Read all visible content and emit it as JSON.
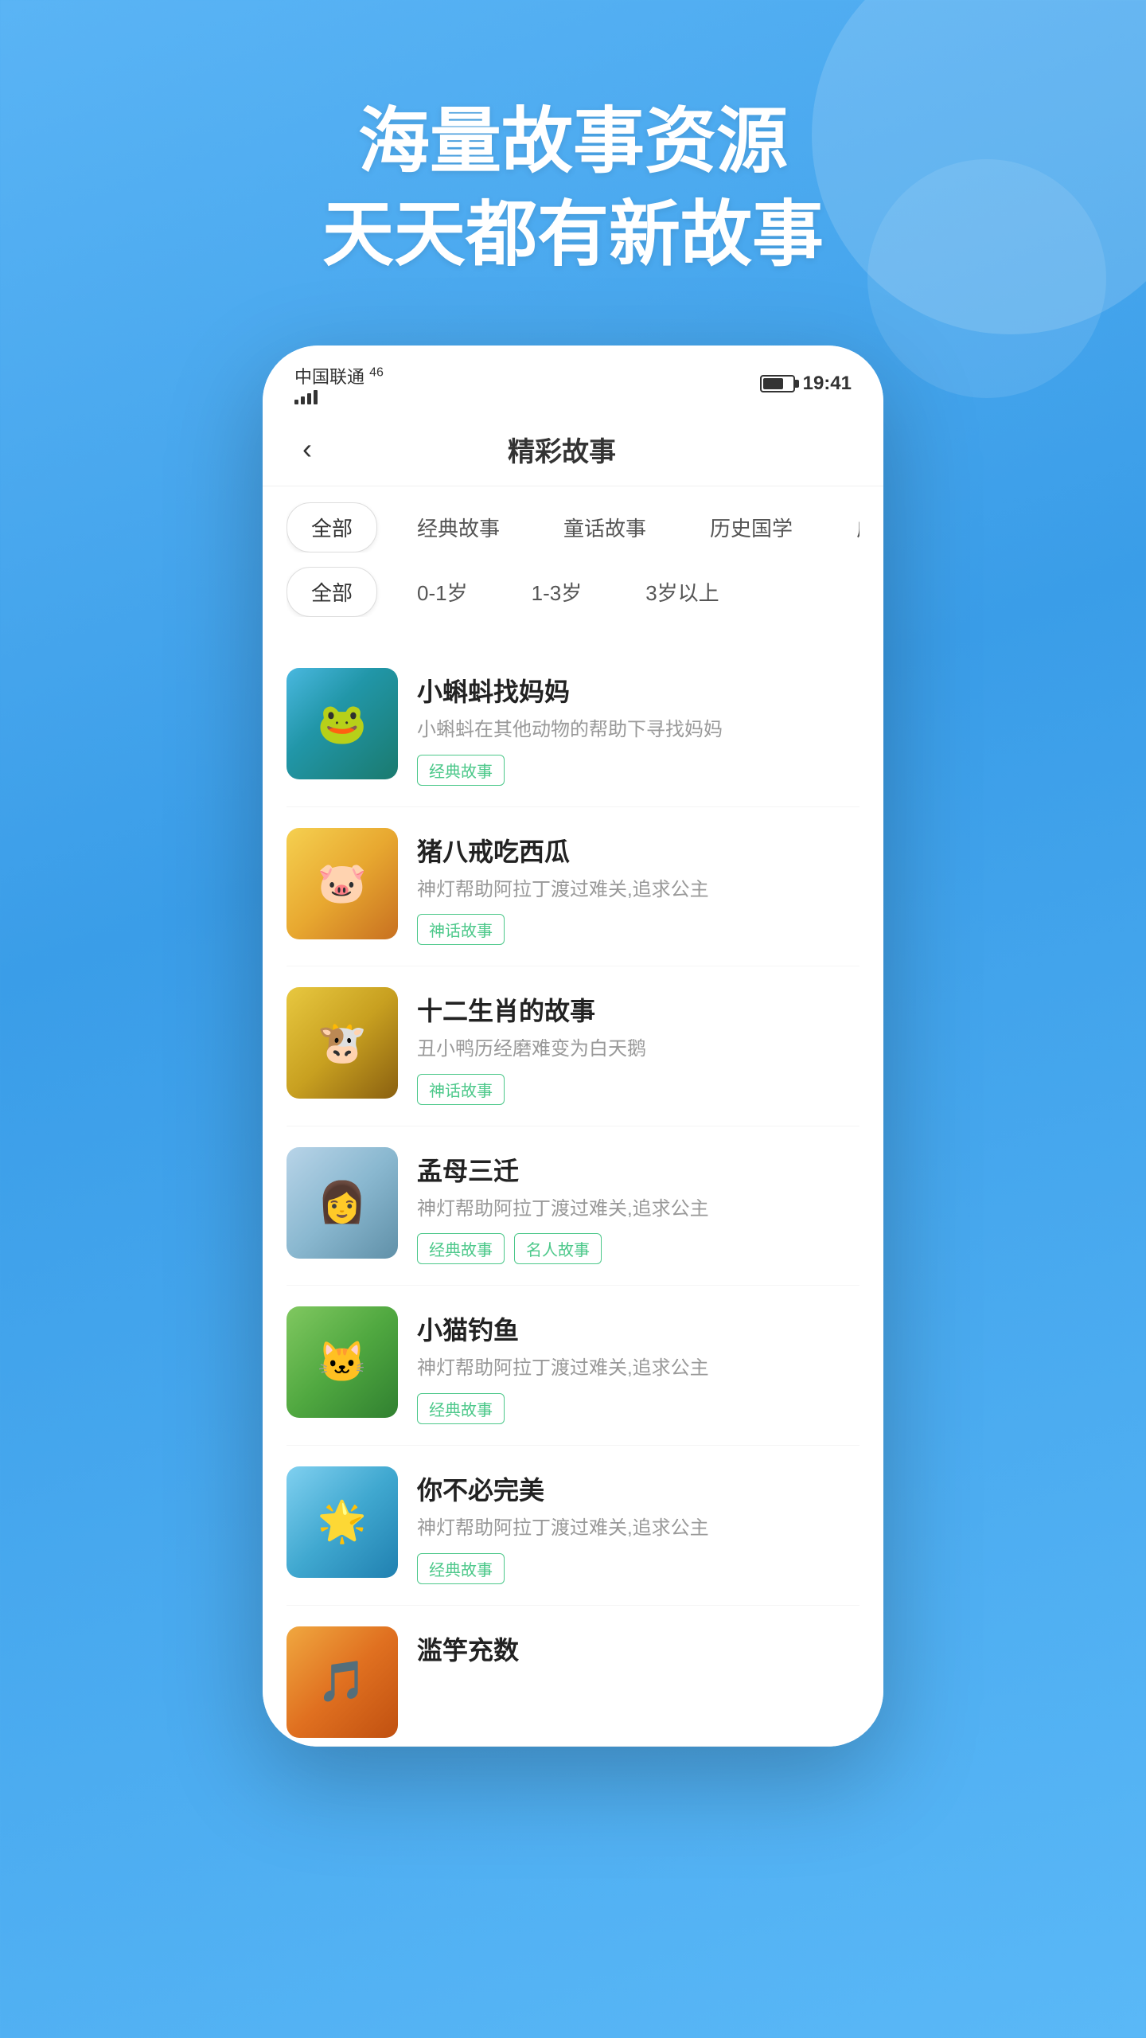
{
  "hero": {
    "line1": "海量故事资源",
    "line2": "天天都有新故事"
  },
  "statusBar": {
    "carrier": "中国联通",
    "signal": "46",
    "time": "19:41"
  },
  "nav": {
    "back": "‹",
    "title": "精彩故事"
  },
  "filters": {
    "categoryRow": [
      {
        "label": "全部",
        "active": true
      },
      {
        "label": "经典故事",
        "active": false
      },
      {
        "label": "童话故事",
        "active": false
      },
      {
        "label": "历史国学",
        "active": false
      },
      {
        "label": "成语故",
        "active": false
      }
    ],
    "ageRow": [
      {
        "label": "全部",
        "active": true
      },
      {
        "label": "0-1岁",
        "active": false
      },
      {
        "label": "1-3岁",
        "active": false
      },
      {
        "label": "3岁以上",
        "active": false
      }
    ]
  },
  "stories": [
    {
      "id": 1,
      "title": "小蝌蚪找妈妈",
      "desc": "小蝌蚪在其他动物的帮助下寻找妈妈",
      "tags": [
        "经典故事"
      ],
      "coverEmoji": "🐸",
      "coverClass": "cover-1"
    },
    {
      "id": 2,
      "title": "猪八戒吃西瓜",
      "desc": "神灯帮助阿拉丁渡过难关,追求公主",
      "tags": [
        "神话故事"
      ],
      "coverEmoji": "🐷",
      "coverClass": "cover-2"
    },
    {
      "id": 3,
      "title": "十二生肖的故事",
      "desc": "丑小鸭历经磨难变为白天鹅",
      "tags": [
        "神话故事"
      ],
      "coverEmoji": "🐮",
      "coverClass": "cover-3"
    },
    {
      "id": 4,
      "title": "孟母三迁",
      "desc": "神灯帮助阿拉丁渡过难关,追求公主",
      "tags": [
        "经典故事",
        "名人故事"
      ],
      "coverEmoji": "👩",
      "coverClass": "cover-4"
    },
    {
      "id": 5,
      "title": "小猫钓鱼",
      "desc": "神灯帮助阿拉丁渡过难关,追求公主",
      "tags": [
        "经典故事"
      ],
      "coverEmoji": "🐱",
      "coverClass": "cover-5"
    },
    {
      "id": 6,
      "title": "你不必完美",
      "desc": "神灯帮助阿拉丁渡过难关,追求公主",
      "tags": [
        "经典故事"
      ],
      "coverEmoji": "🌟",
      "coverClass": "cover-6"
    },
    {
      "id": 7,
      "title": "滥竽充数",
      "desc": "",
      "tags": [],
      "coverEmoji": "🎵",
      "coverClass": "cover-7"
    }
  ]
}
